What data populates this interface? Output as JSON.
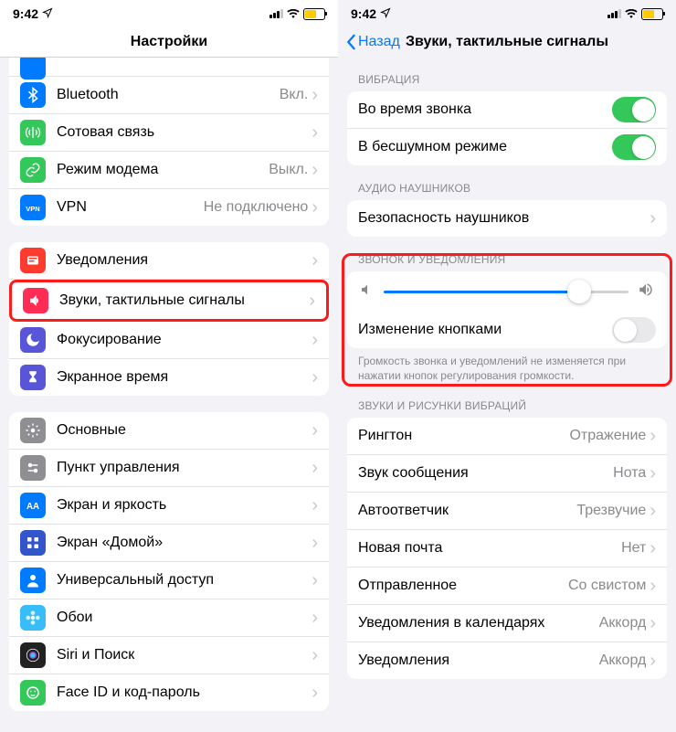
{
  "status": {
    "time": "9:42"
  },
  "left": {
    "title": "Настройки",
    "rows1": [
      {
        "label": "Bluetooth",
        "value": "Вкл.",
        "color": "#007aff",
        "icon": "bluetooth"
      },
      {
        "label": "Сотовая связь",
        "value": "",
        "color": "#34c759",
        "icon": "antenna"
      },
      {
        "label": "Режим модема",
        "value": "Выкл.",
        "color": "#34c759",
        "icon": "link"
      },
      {
        "label": "VPN",
        "value": "Не подключено",
        "color": "#007aff",
        "icon": "vpn"
      }
    ],
    "rows2": [
      {
        "label": "Уведомления",
        "color": "#ff3b30",
        "icon": "bell"
      },
      {
        "label": "Звуки, тактильные сигналы",
        "color": "#ff2d55",
        "icon": "speaker",
        "highlight": true
      },
      {
        "label": "Фокусирование",
        "color": "#5856d6",
        "icon": "moon"
      },
      {
        "label": "Экранное время",
        "color": "#5856d6",
        "icon": "hourglass"
      }
    ],
    "rows3": [
      {
        "label": "Основные",
        "color": "#8e8e93",
        "icon": "gear"
      },
      {
        "label": "Пункт управления",
        "color": "#8e8e93",
        "icon": "switches"
      },
      {
        "label": "Экран и яркость",
        "color": "#007aff",
        "icon": "aa"
      },
      {
        "label": "Экран «Домой»",
        "color": "#3355cc",
        "icon": "grid"
      },
      {
        "label": "Универсальный доступ",
        "color": "#007aff",
        "icon": "person"
      },
      {
        "label": "Обои",
        "color": "#38bdf8",
        "icon": "flower"
      },
      {
        "label": "Siri и Поиск",
        "color": "#222222",
        "icon": "siri"
      },
      {
        "label": "Face ID и код-пароль",
        "color": "#34c759",
        "icon": "face"
      }
    ]
  },
  "right": {
    "back": "Назад",
    "title": "Звуки, тактильные сигналы",
    "headers": {
      "vibration": "ВИБРАЦИЯ",
      "audio": "АУДИО НАУШНИКОВ",
      "ringer": "ЗВОНОК И УВЕДОМЛЕНИЯ",
      "sounds": "ЗВУКИ И РИСУНКИ ВИБРАЦИЙ"
    },
    "vibration": [
      {
        "label": "Во время звонка",
        "toggle": true
      },
      {
        "label": "В бесшумном режиме",
        "toggle": true
      }
    ],
    "audio": {
      "label": "Безопасность наушников"
    },
    "ringer": {
      "change_label": "Изменение кнопками",
      "change_toggle": false,
      "footer": "Громкость звонка и уведомлений не изменяется при нажатии кнопок регулирования громкости."
    },
    "sounds": [
      {
        "label": "Рингтон",
        "value": "Отражение"
      },
      {
        "label": "Звук сообщения",
        "value": "Нота"
      },
      {
        "label": "Автоответчик",
        "value": "Трезвучие"
      },
      {
        "label": "Новая почта",
        "value": "Нет"
      },
      {
        "label": "Отправленное",
        "value": "Со свистом"
      },
      {
        "label": "Уведомления в календарях",
        "value": "Аккорд"
      },
      {
        "label": "Уведомления",
        "value": "Аккорд"
      }
    ]
  }
}
